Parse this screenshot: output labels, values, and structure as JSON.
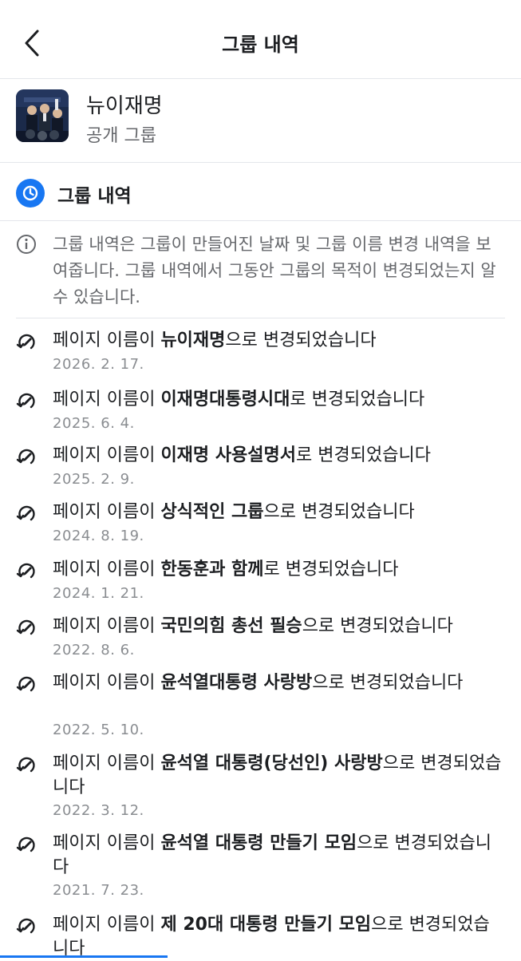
{
  "header": {
    "title": "그룹 내역",
    "back_label": ""
  },
  "group": {
    "name": "뉴이재명",
    "type": "공개 그룹"
  },
  "section": {
    "title": "그룹 내역"
  },
  "info": {
    "text": "그룹 내역은 그룹이 만들어진 날짜 및 그룹 이름 변경 내역을 보여줍니다. 그룹 내역에서 그동안 그룹의 목적이 변경되었는지 알 수 있습니다."
  },
  "entries": [
    {
      "prefix": "페이지 이름이 ",
      "name": "뉴이재명",
      "suffix": "으로 변경되었습니다",
      "date": "2026. 2. 17."
    },
    {
      "prefix": "페이지 이름이 ",
      "name": "이재명대통령시대",
      "suffix": "로 변경되었습니다",
      "date": "2025. 6. 4."
    },
    {
      "prefix": "페이지 이름이 ",
      "name": "이재명 사용설명서",
      "suffix": "로 변경되었습니다",
      "date": "2025. 2. 9."
    },
    {
      "prefix": "페이지 이름이 ",
      "name": "상식적인 그룹",
      "suffix": "으로 변경되었습니다",
      "date": "2024. 8. 19."
    },
    {
      "prefix": "페이지 이름이 ",
      "name": "한동훈과 함께",
      "suffix": "로 변경되었습니다",
      "date": "2024. 1. 21."
    },
    {
      "prefix": "페이지 이름이 ",
      "name": "국민의힘 총선 필승",
      "suffix": "으로 변경되었습니다",
      "date": "2022. 8. 6."
    },
    {
      "prefix": "페이지 이름이 ",
      "name": "윤석열대통령 사랑방",
      "suffix": "으로 변경되었습니다",
      "date": "2022. 5. 10."
    },
    {
      "prefix": "페이지 이름이 ",
      "name": "윤석열 대통령(당선인) 사랑방",
      "suffix": "으로 변경되었습니다",
      "date": "2022. 3. 12."
    },
    {
      "prefix": "페이지 이름이 ",
      "name": "윤석열 대통령 만들기 모임",
      "suffix": "으로 변경되었습니다",
      "date": "2021. 7. 23."
    },
    {
      "prefix": "페이지 이름이 ",
      "name": "제 20대 대통령 만들기 모임",
      "suffix": "으로 변경되었습니다",
      "date": ""
    }
  ]
}
